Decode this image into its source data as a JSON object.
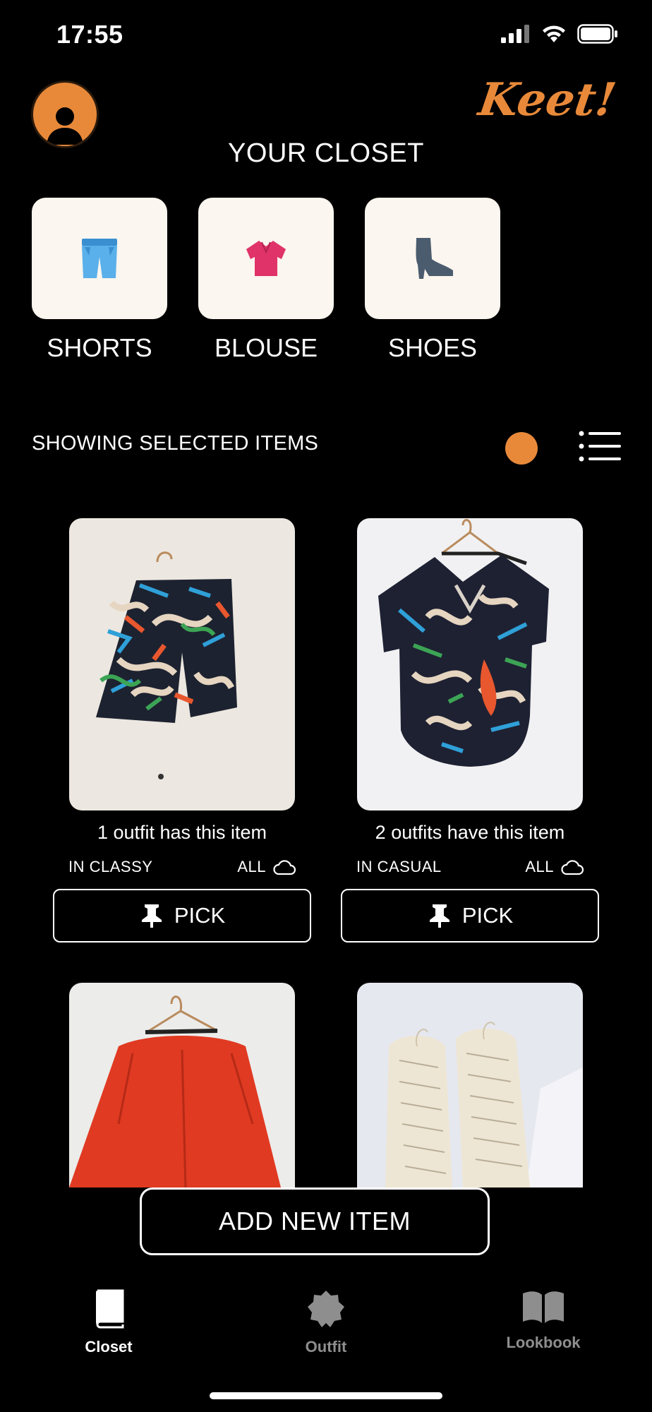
{
  "status_bar": {
    "time": "17:55"
  },
  "header": {
    "brand": "Keet!",
    "title": "YOUR CLOSET"
  },
  "categories": [
    {
      "label": "SHORTS",
      "icon": "shorts-icon"
    },
    {
      "label": "BLOUSE",
      "icon": "blouse-icon"
    },
    {
      "label": "SHOES",
      "icon": "boot-icon"
    }
  ],
  "filter": {
    "showing_text": "SHOWING SELECTED ITEMS"
  },
  "items": [
    {
      "count_text": "1 outfit has this item",
      "collection": "IN CLASSY",
      "season": "ALL",
      "pick_label": "PICK"
    },
    {
      "count_text": "2 outfits have this item",
      "collection": "IN CASUAL",
      "season": "ALL",
      "pick_label": "PICK"
    }
  ],
  "add_button": {
    "label": "ADD NEW ITEM"
  },
  "tabs": [
    {
      "label": "Closet",
      "active": true
    },
    {
      "label": "Outfit",
      "active": false
    },
    {
      "label": "Lookbook",
      "active": false
    }
  ],
  "colors": {
    "accent": "#E8893A",
    "card": "#FBF6EF",
    "inactive_tab": "#8E8E8E"
  }
}
